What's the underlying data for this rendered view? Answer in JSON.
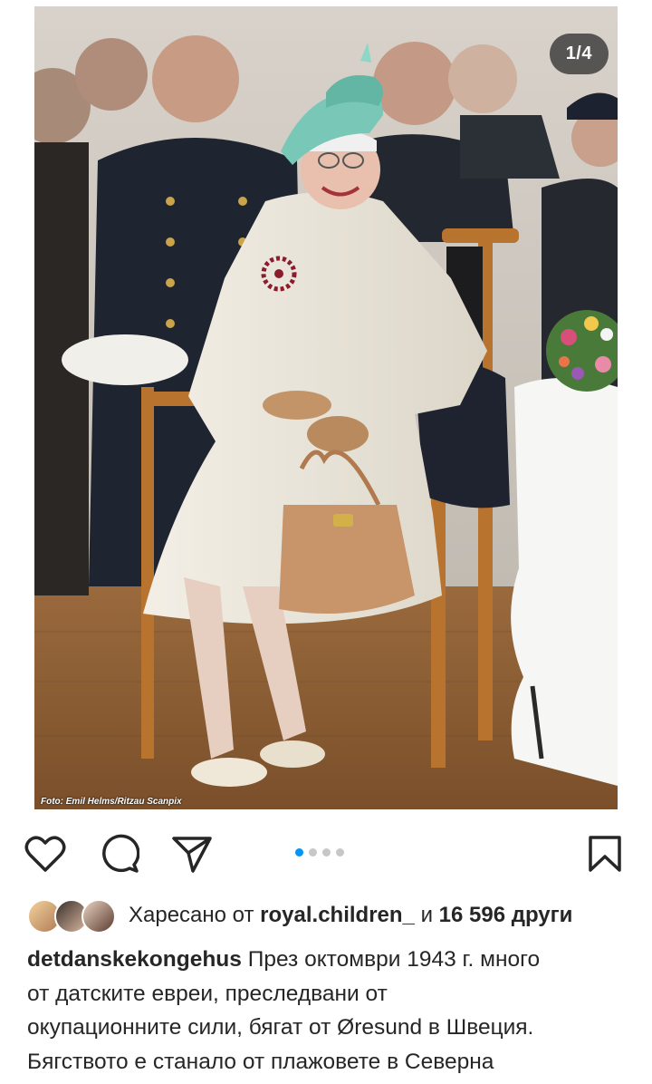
{
  "post": {
    "counter": "1/4",
    "photo_credit": "Foto: Emil Helms/Ritzau Scanpix",
    "carousel": {
      "total": 4,
      "active": 1
    }
  },
  "actions": {
    "like_icon": "heart-icon",
    "comment_icon": "comment-icon",
    "share_icon": "send-icon",
    "save_icon": "bookmark-icon"
  },
  "likes": {
    "prefix": "Харесано от",
    "user": "royal.children_",
    "conjunction": "и",
    "count": "16 596 други"
  },
  "caption": {
    "username": "detdanskekongehus",
    "lines": [
      "През октомври 1943 г. много",
      "от датските евреи, преследвани от",
      "окупационните сили, бягат от Øresund в Швеция.",
      "Бягството е станало от плажовете в Северна"
    ]
  },
  "colors": {
    "accent": "#0095f6",
    "text": "#262626",
    "hat": "#79c7b7",
    "coat": "#eeeae0",
    "handbag": "#c8946a"
  }
}
